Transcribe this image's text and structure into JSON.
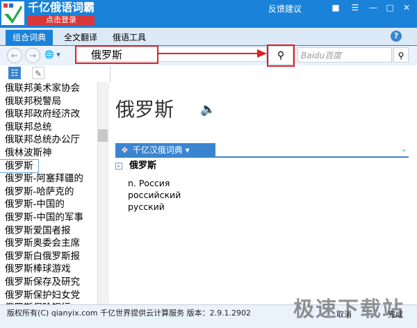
{
  "app": {
    "title": "千亿俄语词霸",
    "login_label": "点击登录",
    "feedback_label": "反馈建议",
    "window_buttons": [
      "shirt-icon",
      "menu-icon",
      "minimize-icon",
      "restore-icon",
      "close-icon"
    ]
  },
  "tabs": [
    "组合词典",
    "全文翻译",
    "俄语工具"
  ],
  "help_label": "?",
  "search": {
    "value": "俄罗斯",
    "baidu_placeholder": "Baidu百度"
  },
  "sidebar": {
    "words": [
      "俄联邦美术家协会",
      "俄联邦税警局",
      "俄联邦政府经济改",
      "俄联邦总统",
      "俄联邦总统办公厅",
      "俄林波斯神",
      "俄罗斯",
      "俄罗斯-阿塞拜疆的",
      "俄罗斯-哈萨克的",
      "俄罗斯-中国的",
      "俄罗斯-中国的军事",
      "俄罗斯爱国者报",
      "俄罗斯奥委会主席",
      "俄罗斯白俄罗斯报",
      "俄罗斯棒球游戏",
      "俄罗斯保存及研究",
      "俄罗斯保护妇女党",
      "俄罗斯保险银行"
    ],
    "selected_index": 6
  },
  "main": {
    "headword": "俄罗斯",
    "dict_name": "千亿汉俄词典",
    "entry_word": "俄罗斯",
    "definitions": [
      "n. Россия",
      "российский",
      "русский"
    ]
  },
  "status": {
    "text": "版权所有(C) qianyix.com 千亿世界提供云计算服务 版本：2.9.1.2902",
    "cancel": "取消",
    "confirm": "完成"
  },
  "watermark": "极速下载站",
  "colors": {
    "title_bar": "#1a82d8",
    "accent": "#3a84d0",
    "highlight_box": "#e02020",
    "login": "#d9383a"
  }
}
